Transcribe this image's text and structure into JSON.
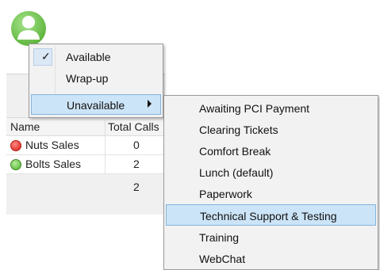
{
  "avatar": {
    "icon": "user-avatar-icon",
    "color": "#6cc24a"
  },
  "table": {
    "columns": [
      "Name",
      "Total Calls"
    ],
    "rows": [
      {
        "status": "red",
        "name": "Nuts Sales",
        "calls": "0"
      },
      {
        "status": "green",
        "name": "Bolts Sales",
        "calls": "2"
      }
    ],
    "total": "2"
  },
  "status_menu": {
    "items": [
      {
        "label": "Available",
        "checked": true
      },
      {
        "label": "Wrap-up",
        "checked": false
      },
      {
        "label": "Unavailable",
        "has_submenu": true,
        "highlighted": true
      }
    ]
  },
  "unavailable_submenu": {
    "items": [
      {
        "label": "Awaiting PCI Payment"
      },
      {
        "label": "Clearing Tickets"
      },
      {
        "label": "Comfort Break"
      },
      {
        "label": "Lunch (default)"
      },
      {
        "label": "Paperwork"
      },
      {
        "label": "Technical Support & Testing",
        "highlighted": true
      },
      {
        "label": "Training"
      },
      {
        "label": "WebChat"
      }
    ]
  },
  "colors": {
    "highlight": "#cce4f7",
    "highlight_border": "#82b4de",
    "available": "#6cc24a",
    "unavailable": "#e23a32"
  }
}
